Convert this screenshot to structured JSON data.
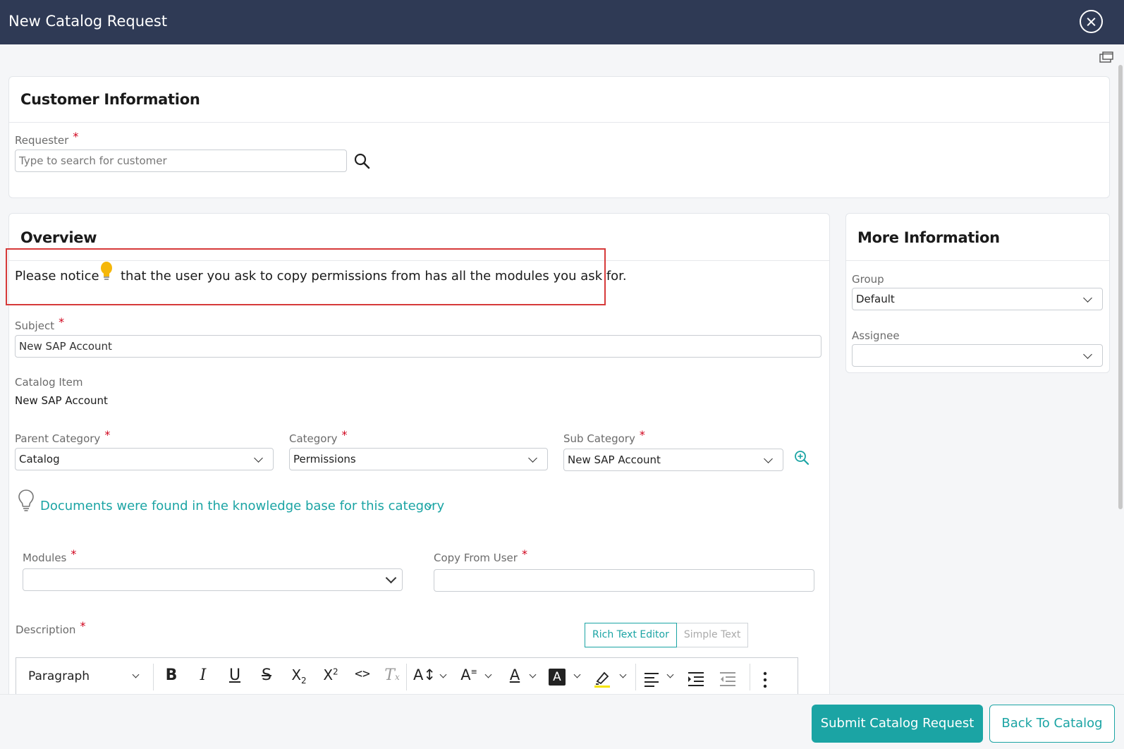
{
  "window": {
    "title": "New Catalog Request",
    "close_icon": "close-circle-icon"
  },
  "customer": {
    "title": "Customer Information",
    "requester_label": "Requester",
    "requester_placeholder": "Type to search for customer",
    "search_icon": "search-icon"
  },
  "overview": {
    "title": "Overview",
    "notice_before": "Please notice",
    "notice_icon": "lightbulb-icon",
    "notice_after": "that the user you ask to copy permissions from has all the modules you ask for.",
    "subject_label": "Subject",
    "subject_value": "New SAP Account",
    "catalog_item_label": "Catalog Item",
    "catalog_item_value": "New SAP Account",
    "parent_category_label": "Parent Category",
    "parent_category_value": "Catalog",
    "category_label": "Category",
    "category_value": "Permissions",
    "sub_category_label": "Sub Category",
    "sub_category_value": "New SAP Account",
    "kb_text": "Documents were found in the knowledge base for this category",
    "modules_label": "Modules",
    "modules_value": "",
    "copy_from_label": "Copy From User",
    "copy_from_value": "",
    "description_label": "Description",
    "rich_text_label": "Rich Text Editor",
    "simple_text_label": "Simple Text",
    "paragraph_label": "Paragraph"
  },
  "more_info": {
    "title": "More Information",
    "group_label": "Group",
    "group_value": "Default",
    "assignee_label": "Assignee",
    "assignee_value": ""
  },
  "footer": {
    "submit_label": "Submit Catalog Request",
    "back_label": "Back To Catalog"
  },
  "colors": {
    "header": "#2f3a55",
    "accent": "#1ba4a4",
    "required": "#d0021b",
    "notice_border": "#d63a3a"
  }
}
